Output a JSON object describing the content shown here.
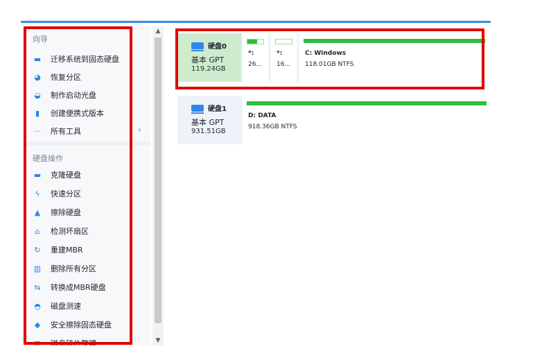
{
  "sidebar": {
    "section_wizard": "向导",
    "wizard_items": [
      {
        "label": "迁移系统到固态硬盘",
        "icon": "migrate-os-icon"
      },
      {
        "label": "恢复分区",
        "icon": "recover-partition-icon"
      },
      {
        "label": "制作启动光盘",
        "icon": "boot-disc-icon"
      },
      {
        "label": "创建便携式版本",
        "icon": "portable-icon"
      },
      {
        "label": "所有工具",
        "icon": "more-icon"
      }
    ],
    "section_ops": "硬盘操作",
    "ops_items": [
      {
        "label": "克隆硬盘",
        "icon": "clone-disk-icon"
      },
      {
        "label": "快速分区",
        "icon": "quick-partition-icon"
      },
      {
        "label": "擦除硬盘",
        "icon": "wipe-disk-icon"
      },
      {
        "label": "检测坏扇区",
        "icon": "bad-sector-icon"
      },
      {
        "label": "重建MBR",
        "icon": "rebuild-mbr-icon"
      },
      {
        "label": "删除所有分区",
        "icon": "delete-partitions-icon"
      },
      {
        "label": "转换成MBR硬盘",
        "icon": "convert-mbr-icon"
      },
      {
        "label": "磁盘测速",
        "icon": "disk-speed-icon"
      },
      {
        "label": "安全擦除固态硬盘",
        "icon": "ssd-secure-erase-icon"
      },
      {
        "label": "磁盘碎片整理",
        "icon": "defrag-icon"
      }
    ]
  },
  "disks": [
    {
      "name": "硬盘0",
      "type": "基本 GPT",
      "size": "119.24GB",
      "partitions": [
        {
          "label": "*:",
          "size": "26...",
          "used": 0.6
        },
        {
          "label": "*:",
          "size": "16...",
          "used": 0.0
        },
        {
          "label": "C: Windows",
          "size": "118.01GB NTFS",
          "used": 1.0
        }
      ]
    },
    {
      "name": "硬盘1",
      "type": "基本 GPT",
      "size": "931.51GB",
      "partitions": [
        {
          "label": "D: DATA",
          "size": "918.36GB NTFS",
          "used": 1.0
        }
      ]
    }
  ],
  "colors": {
    "accent": "#2f86e9",
    "used_bar": "#2ebd3d",
    "selected_disk": "#cdeccd",
    "highlight_box": "#e00000"
  }
}
